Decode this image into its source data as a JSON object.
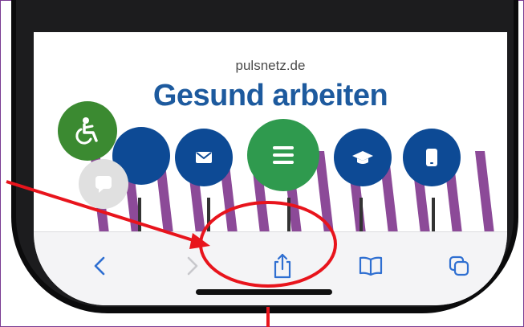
{
  "browser": {
    "domain": "pulsnetz.de"
  },
  "page": {
    "title": "Gesund arbeiten"
  },
  "icons": {
    "accessibility": "wheelchair-icon",
    "chat": "chat-icon",
    "mail": "mail-icon",
    "menu": "menu-icon",
    "education": "graduation-cap-icon",
    "phone": "smartphone-icon",
    "back": "back-chevron-icon",
    "forward": "forward-chevron-icon",
    "share": "share-icon",
    "bookmarks": "book-icon",
    "tabs": "tabs-icon"
  },
  "colors": {
    "brand_blue": "#1d5a9e",
    "nav_blue": "#0d4a95",
    "nav_green": "#2f9a4e",
    "stripe_purple": "#8c4a98",
    "toolbar_tint": "#2f6fd1",
    "annotation_red": "#e8141c"
  }
}
